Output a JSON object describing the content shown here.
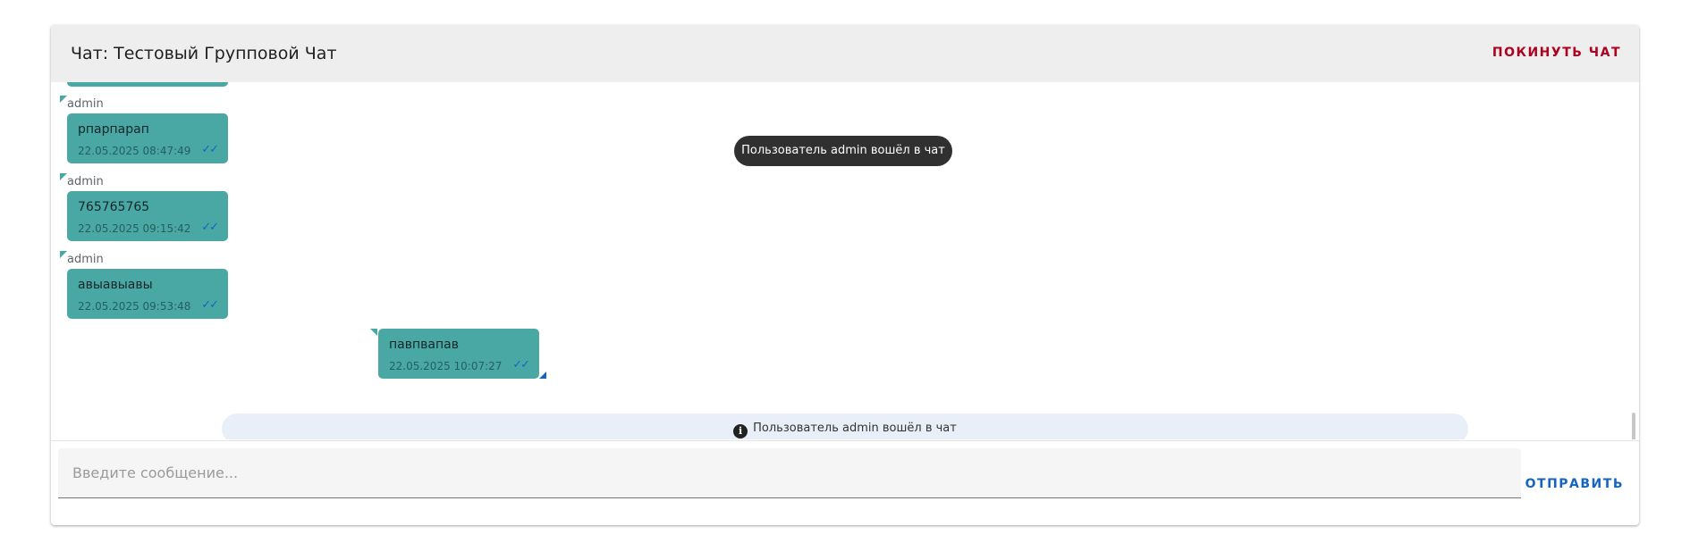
{
  "header": {
    "title": "Чат: Тестовый Групповой Чат",
    "leave_label": "ПОКИНУТЬ ЧАТ"
  },
  "toast": {
    "text": "Пользователь admin вошёл в чат"
  },
  "messages": [
    {
      "sender": "admin",
      "text": "рпарпарап",
      "time": "22.05.2025 08:47:49",
      "ticks": "✓✓",
      "own": false
    },
    {
      "sender": "admin",
      "text": "765765765",
      "time": "22.05.2025 09:15:42",
      "ticks": "✓✓",
      "own": false
    },
    {
      "sender": "admin",
      "text": "авыавыавы",
      "time": "22.05.2025 09:53:48",
      "ticks": "✓✓",
      "own": false
    },
    {
      "sender": "",
      "text": "павпвапав",
      "time": "22.05.2025 10:07:27",
      "ticks": "✓✓",
      "own": true
    }
  ],
  "system_message": {
    "icon": "info-icon",
    "text": "Пользователь admin вошёл в чат"
  },
  "composer": {
    "placeholder": "Введите сообщение...",
    "value": "",
    "send_label": "ОТПРАВИТЬ"
  },
  "colors": {
    "own_bubble": "#4aa8a4",
    "other_bubble": "#4aa8a4",
    "leave_accent": "#b00020",
    "send_accent": "#1565c0",
    "read_ticks": "#1565c0"
  }
}
